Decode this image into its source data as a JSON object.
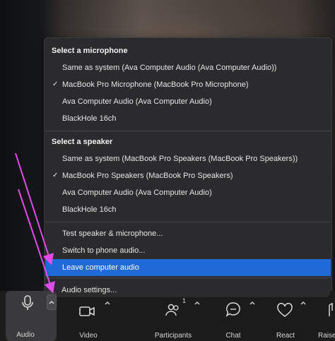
{
  "menu": {
    "microphone_header": "Select a microphone",
    "microphones": [
      {
        "label": "Same as system (Ava Computer Audio (Ava Computer Audio))",
        "checked": false
      },
      {
        "label": "MacBook Pro Microphone (MacBook Pro Microphone)",
        "checked": true
      },
      {
        "label": "Ava Computer Audio (Ava Computer Audio)",
        "checked": false
      },
      {
        "label": "BlackHole 16ch",
        "checked": false
      }
    ],
    "speaker_header": "Select a speaker",
    "speakers": [
      {
        "label": "Same as system (MacBook Pro Speakers (MacBook Pro Speakers))",
        "checked": false
      },
      {
        "label": "MacBook Pro Speakers (MacBook Pro Speakers)",
        "checked": true
      },
      {
        "label": "Ava Computer Audio (Ava Computer Audio)",
        "checked": false
      },
      {
        "label": "BlackHole 16ch",
        "checked": false
      }
    ],
    "check_mark": "✓",
    "test_label": "Test speaker & microphone...",
    "phone_label": "Switch to phone audio...",
    "leave_label": "Leave computer audio",
    "settings_label": "Audio settings..."
  },
  "toolbar": {
    "audio_label": "Audio",
    "video_label": "Video",
    "participants_label": "Participants",
    "participants_count": "1",
    "chat_label": "Chat",
    "react_label": "React",
    "raise_label": "Raise",
    "caret_glyph": "^"
  },
  "colors": {
    "highlight": "#1f6ad6",
    "annotation_arrow": "#e24be8",
    "menu_bg": "#2b2b2d"
  },
  "icons": [
    "microphone-icon",
    "video-camera-icon",
    "participants-icon",
    "chat-icon",
    "react-heart-icon",
    "raise-hand-icon",
    "chevron-up-icon"
  ]
}
